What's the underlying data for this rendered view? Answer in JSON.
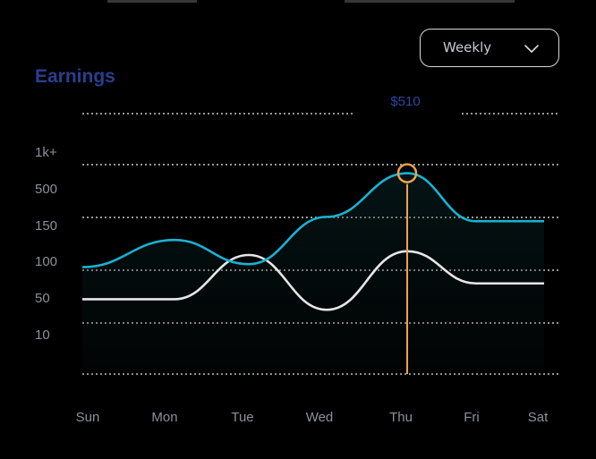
{
  "header": {
    "title": "Earnings"
  },
  "period_select": {
    "value": "Weekly"
  },
  "colors": {
    "primary": "#19b2d3",
    "secondary": "#e6e6e6",
    "highlight": "#f0a24a",
    "title": "#2b3e8f"
  },
  "chart_data": {
    "type": "line",
    "title": "Earnings",
    "categories": [
      "Sun",
      "Mon",
      "Tue",
      "Wed",
      "Thu",
      "Fri",
      "Sat"
    ],
    "y_tick_labels": [
      "1k+",
      "500",
      "150",
      "100",
      "50",
      "10"
    ],
    "grid": true,
    "series": [
      {
        "values": [
          60,
          120,
          70,
          155,
          700,
          145,
          145
        ]
      },
      {
        "values": [
          28,
          28,
          100,
          20,
          105,
          40,
          40
        ]
      }
    ],
    "highlight": {
      "category": "Thu",
      "value": 510,
      "label": "$510"
    }
  }
}
